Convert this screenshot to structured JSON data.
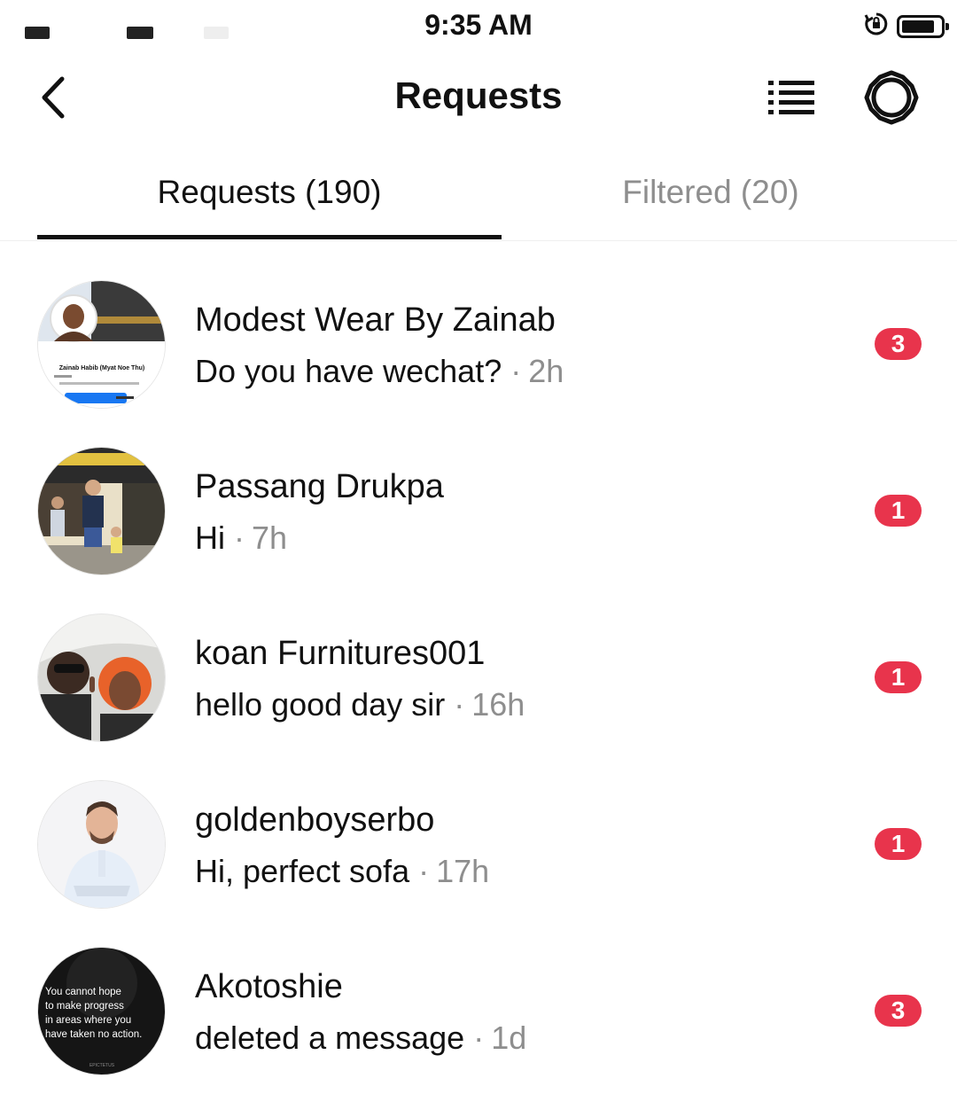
{
  "status_bar": {
    "time": "9:35 AM"
  },
  "header": {
    "title": "Requests"
  },
  "tabs": [
    {
      "label": "Requests (190)",
      "active": true
    },
    {
      "label": "Filtered (20)",
      "active": false
    }
  ],
  "requests": [
    {
      "name": "Modest Wear By Zainab",
      "message": "Do you have wechat?",
      "time": "2h",
      "badge": "3"
    },
    {
      "name": "Passang Drukpa",
      "message": "Hi",
      "time": "7h",
      "badge": "1"
    },
    {
      "name": "koan Furnitures001",
      "message": "hello good day sir",
      "time": "16h",
      "badge": "1"
    },
    {
      "name": "goldenboyserbo",
      "message": "Hi, perfect sofa",
      "time": "17h",
      "badge": "1"
    },
    {
      "name": "Akotoshie",
      "message": "deleted a message",
      "time": "1d",
      "badge": "3"
    }
  ],
  "avatar_texts": {
    "zainab_profile_name": "Zainab Habib (Myat Noe Thu)",
    "quote_line1": "You cannot hope",
    "quote_line2": "to make progress",
    "quote_line3": "in areas where you",
    "quote_line4": "have taken no action.",
    "quote_author": "EPICTETUS"
  },
  "colors": {
    "badge": "#e8344c",
    "muted_text": "#8e8e8e",
    "primary_text": "#111111"
  },
  "separator": "·"
}
